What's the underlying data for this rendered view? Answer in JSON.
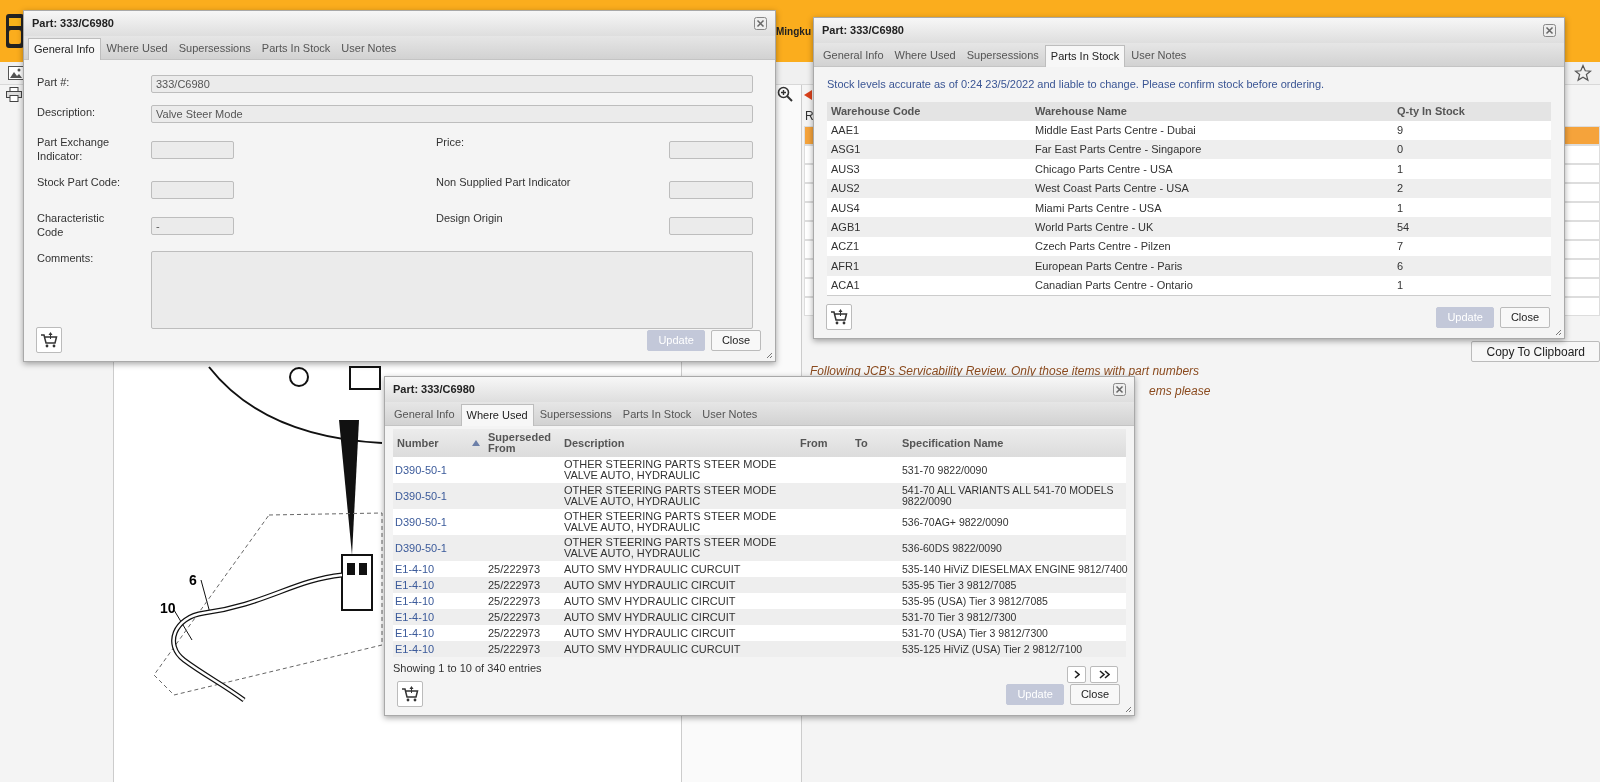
{
  "header": {
    "user_fragment": "Mingku"
  },
  "parts_list": {
    "column_1": "R",
    "rows": [
      {
        "selected": true
      },
      {
        "selected": false
      },
      {
        "selected": false
      },
      {
        "selected": false
      },
      {
        "selected": false
      },
      {
        "selected": false
      },
      {
        "selected": false
      },
      {
        "selected": false
      },
      {
        "selected": false
      },
      {
        "selected": false
      }
    ]
  },
  "copy_button": "Copy To Clipboard",
  "notice_lines": [
    "Following JCB's Servicability Review. Only those items with part numbers",
    "ems please"
  ],
  "drawing": {
    "callouts": [
      "10",
      "6"
    ]
  },
  "dialogs": [
    {
      "kind": "general",
      "title": "Part: 333/C6980",
      "tabs": [
        {
          "label": "General Info",
          "selected": true
        },
        {
          "label": "Where Used",
          "selected": false
        },
        {
          "label": "Supersessions",
          "selected": false
        },
        {
          "label": "Parts In Stock",
          "selected": false
        },
        {
          "label": "User Notes",
          "selected": false
        }
      ],
      "rows": [
        [
          {
            "label": "Part #:",
            "value": "333/C6980",
            "kind": "wide"
          }
        ],
        [
          {
            "label": "Description:",
            "value": "Valve Steer Mode",
            "kind": "wide"
          }
        ],
        [
          {
            "label": "Part Exchange Indicator:",
            "kind": "short"
          },
          {
            "label": "Price:",
            "kind": "short"
          }
        ],
        [
          {
            "label": "Stock Part Code:",
            "kind": "short"
          },
          {
            "label": "Non Supplied Part Indicator",
            "kind": "short"
          }
        ],
        [
          {
            "label": "Characteristic Code",
            "value": "-",
            "kind": "short"
          },
          {
            "label": "Design Origin",
            "kind": "short"
          }
        ],
        [
          {
            "label": "Comments:",
            "kind": "textarea"
          }
        ]
      ],
      "buttons": [
        {
          "label": "Update",
          "disabled": true
        },
        {
          "label": "Close",
          "disabled": false
        }
      ]
    },
    {
      "kind": "stock",
      "title": "Part: 333/C6980",
      "tabs": [
        {
          "label": "General Info",
          "selected": false
        },
        {
          "label": "Where Used",
          "selected": false
        },
        {
          "label": "Supersessions",
          "selected": false
        },
        {
          "label": "Parts In Stock",
          "selected": true
        },
        {
          "label": "User Notes",
          "selected": false
        }
      ],
      "note": "Stock levels accurate as of 0:24 23/5/2022 and liable to change. Please confirm stock before ordering.",
      "table": {
        "columns": [
          "Warehouse Code",
          "Warehouse Name",
          "Q-ty In Stock"
        ],
        "rows": [
          [
            "AAE1",
            "Middle East Parts Centre - Dubai",
            "9"
          ],
          [
            "ASG1",
            "Far East Parts Centre - Singapore",
            "0"
          ],
          [
            "AUS3",
            "Chicago Parts Centre - USA",
            "1"
          ],
          [
            "AUS2",
            "West Coast Parts Centre - USA",
            "2"
          ],
          [
            "AUS4",
            "Miami Parts Centre - USA",
            "1"
          ],
          [
            "AGB1",
            "World Parts Centre - UK",
            "54"
          ],
          [
            "ACZ1",
            "Czech Parts Centre - Pilzen",
            "7"
          ],
          [
            "AFR1",
            "European Parts Centre - Paris",
            "6"
          ],
          [
            "ACA1",
            "Canadian Parts Centre - Ontario",
            "1"
          ]
        ]
      },
      "buttons": [
        {
          "label": "Update",
          "disabled": true
        },
        {
          "label": "Close",
          "disabled": false
        }
      ]
    },
    {
      "kind": "where_used",
      "title": "Part: 333/C6980",
      "tabs": [
        {
          "label": "General Info",
          "selected": false
        },
        {
          "label": "Where Used",
          "selected": true
        },
        {
          "label": "Supersessions",
          "selected": false
        },
        {
          "label": "Parts In Stock",
          "selected": false
        },
        {
          "label": "User Notes",
          "selected": false
        }
      ],
      "table": {
        "columns": [
          {
            "label": "Number",
            "sorted": true
          },
          {
            "label": "Superseded From",
            "sorted": false
          },
          {
            "label": "Description",
            "sorted": false
          },
          {
            "label": "From",
            "sorted": false
          },
          {
            "label": "To",
            "sorted": false
          },
          {
            "label": "Specification Name",
            "sorted": false
          }
        ],
        "rows": [
          [
            "D390-50-1",
            "",
            "OTHER STEERING PARTS STEER MODE VALVE AUTO, HYDRAULIC",
            "",
            "",
            "531-70 9822/0090"
          ],
          [
            "D390-50-1",
            "",
            "OTHER STEERING PARTS STEER MODE VALVE AUTO, HYDRAULIC",
            "",
            "",
            "541-70 ALL VARIANTS ALL 541-70 MODELS 9822/0090"
          ],
          [
            "D390-50-1",
            "",
            "OTHER STEERING PARTS STEER MODE VALVE AUTO, HYDRAULIC",
            "",
            "",
            "536-70AG+ 9822/0090"
          ],
          [
            "D390-50-1",
            "",
            "OTHER STEERING PARTS STEER MODE VALVE AUTO, HYDRAULIC",
            "",
            "",
            "536-60DS 9822/0090"
          ],
          [
            "E1-4-10",
            "25/222973",
            "AUTO SMV HYDRAULIC CURCUIT",
            "",
            "",
            "535-140 HiViZ DIESELMAX ENGINE 9812/7400"
          ],
          [
            "E1-4-10",
            "25/222973",
            "AUTO SMV HYDRAULIC CIRCUIT",
            "",
            "",
            "535-95 Tier 3 9812/7085"
          ],
          [
            "E1-4-10",
            "25/222973",
            "AUTO SMV HYDRAULIC CIRCUIT",
            "",
            "",
            "535-95 (USA) Tier 3 9812/7085"
          ],
          [
            "E1-4-10",
            "25/222973",
            "AUTO SMV HYDRAULIC CIRCUIT",
            "",
            "",
            "531-70 Tier 3 9812/7300"
          ],
          [
            "E1-4-10",
            "25/222973",
            "AUTO SMV HYDRAULIC CIRCUIT",
            "",
            "",
            "531-70 (USA) Tier 3 9812/7300"
          ],
          [
            "E1-4-10",
            "25/222973",
            "AUTO SMV HYDRAULIC CURCUIT",
            "",
            "",
            "535-125 HiViZ (USA) Tier 2 9812/7100"
          ]
        ]
      },
      "info": "Showing 1 to 10 of 340 entries",
      "buttons": [
        {
          "label": "Update",
          "disabled": true
        },
        {
          "label": "Close",
          "disabled": false
        }
      ]
    }
  ]
}
